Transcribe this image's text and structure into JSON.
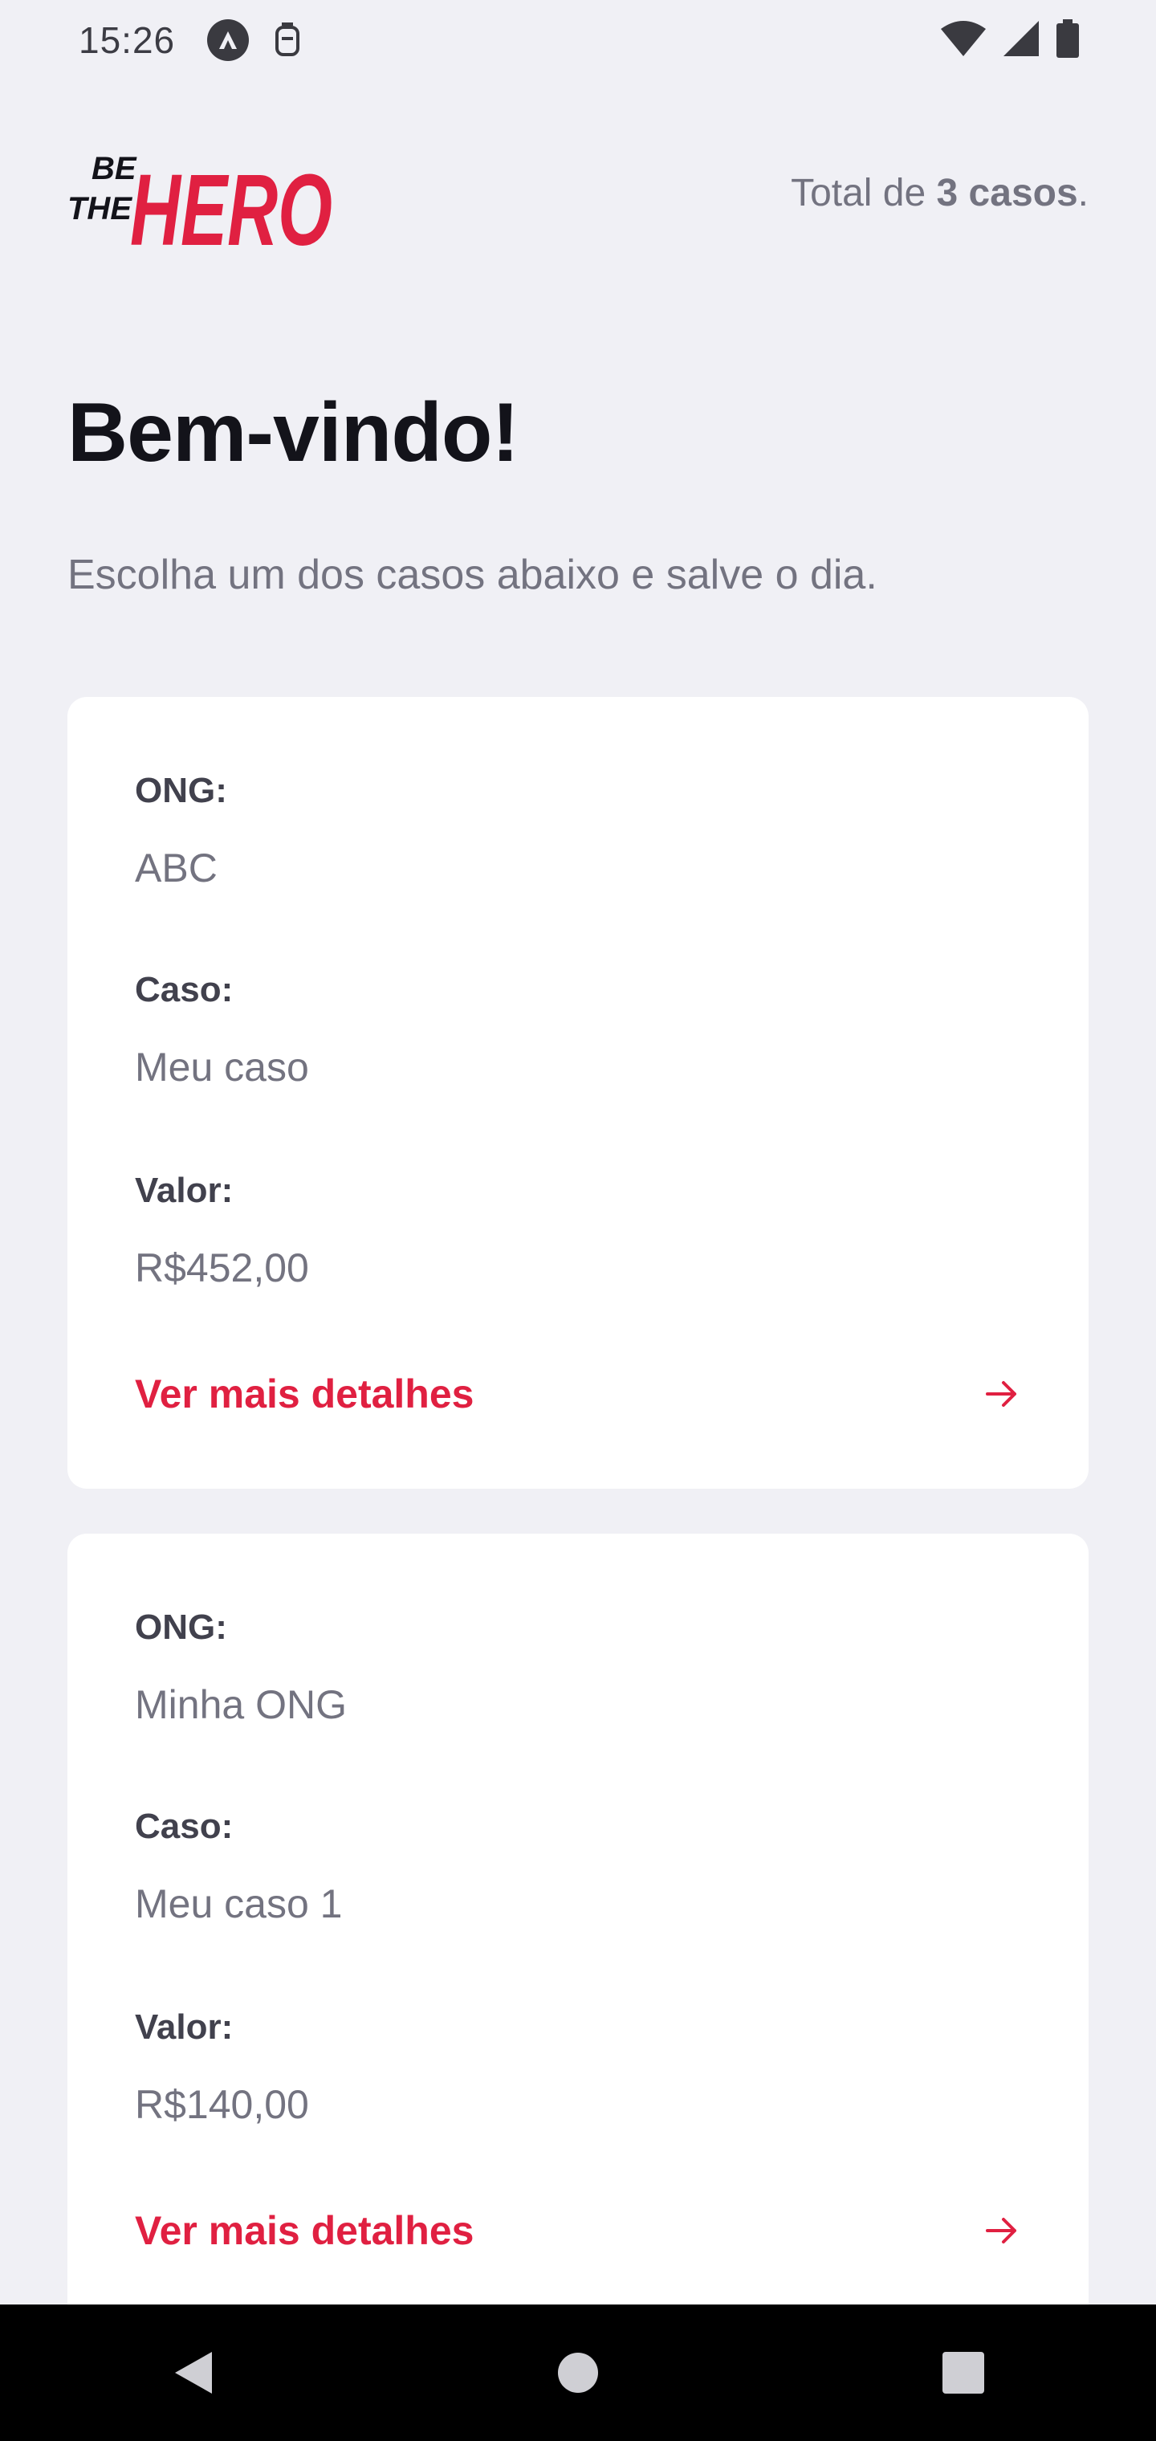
{
  "status_bar": {
    "time": "15:26",
    "icons": [
      "assistant-icon",
      "sim-icon",
      "wifi-icon",
      "signal-icon",
      "battery-icon"
    ]
  },
  "header": {
    "logo_text_small_1": "BE",
    "logo_text_small_2": "THE",
    "logo_text_big": "HERO",
    "total_prefix": "Total de ",
    "total_count": "3 casos",
    "total_suffix": "."
  },
  "title": "Bem-vindo!",
  "description": "Escolha um dos casos abaixo e salve o dia.",
  "incidents": [
    {
      "ong_label": "ONG:",
      "ong_value": "ABC",
      "caso_label": "Caso:",
      "caso_value": "Meu caso",
      "valor_label": "Valor:",
      "valor_value": "R$452,00",
      "details_label": "Ver mais detalhes"
    },
    {
      "ong_label": "ONG:",
      "ong_value": "Minha ONG",
      "caso_label": "Caso:",
      "caso_value": "Meu caso 1",
      "valor_label": "Valor:",
      "valor_value": "R$140,00",
      "details_label": "Ver mais detalhes"
    }
  ],
  "colors": {
    "accent": "#e02041",
    "background": "#f0f0f5",
    "card": "#ffffff",
    "text_dark": "#13131a",
    "text_muted": "#737380"
  },
  "nav": {
    "icons": [
      "back-icon",
      "home-icon",
      "recents-icon"
    ]
  }
}
